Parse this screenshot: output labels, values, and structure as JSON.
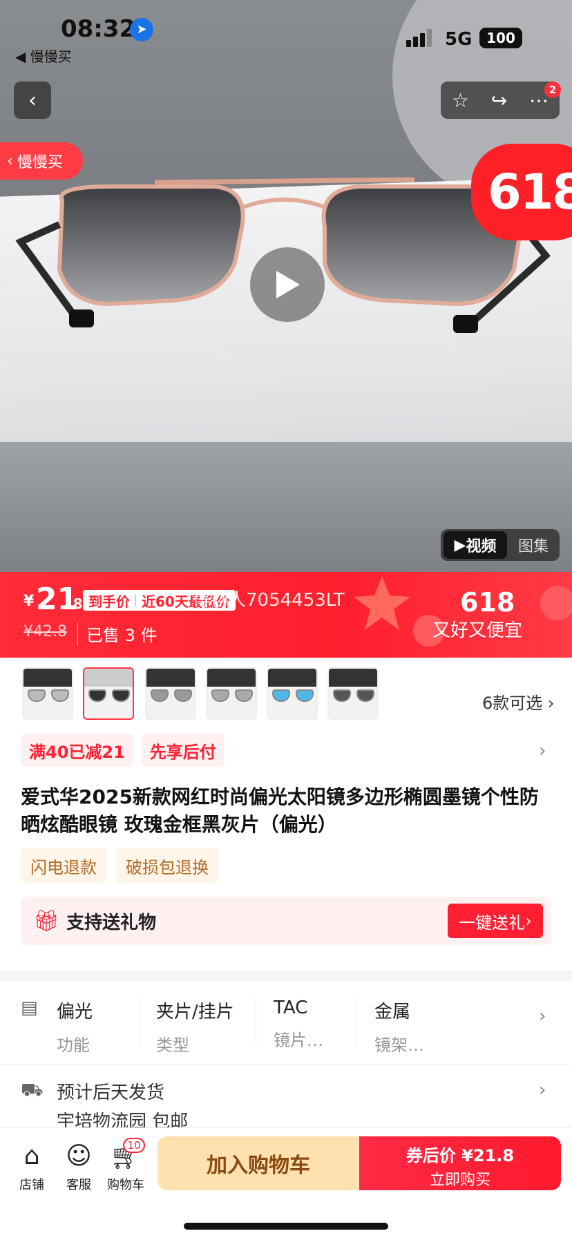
{
  "status_bar": {
    "time": "08:32",
    "back_app": "◀ 慢慢买",
    "network": "5G",
    "battery": "100"
  },
  "hero": {
    "app_pill": "慢慢买",
    "badge_618": "618",
    "media_tabs": [
      "视频",
      "图集"
    ],
    "notification_count": "2"
  },
  "price_bar": {
    "currency": "¥",
    "price_int": "21",
    "price_dec": ".8",
    "tag_1": "到手价",
    "tag_2": "近60天最低价",
    "overlay_text": "得物人7054453LT",
    "old_price": "¥42.8",
    "sold": "已售 3 件",
    "promo_618": "618",
    "promo_text": "又好又便宜"
  },
  "variants": {
    "count_text": "6款可选"
  },
  "promotions": [
    "满40已减21",
    "先享后付"
  ],
  "product_title": "爱式华2025新款网红时尚偏光太阳镜多边形椭圆墨镜个性防晒炫酷眼镜 玫瑰金框黑灰片（偏光）",
  "service_tags": [
    "闪电退款",
    "破损包退换"
  ],
  "gift": {
    "label": "支持送礼物",
    "button": "一键送礼"
  },
  "attributes": [
    {
      "value": "偏光",
      "key": "功能"
    },
    {
      "value": "夹片/挂片",
      "key": "类型"
    },
    {
      "value": "TAC",
      "key": "镜片…"
    },
    {
      "value": "金属",
      "key": "镜架…"
    }
  ],
  "shipping": {
    "line1": "预计后天发货",
    "line2": "宇培物流园  包邮"
  },
  "bottom_bar": {
    "shop": "店铺",
    "service": "客服",
    "cart": "购物车",
    "cart_count": "10",
    "add_to_cart": "加入购物车",
    "buy_line1": "券后价 ¥21.8",
    "buy_line2": "立即购买"
  },
  "colors": {
    "accent_red": "#ff1f2e",
    "tag_bg": "#fff0f1",
    "service_bg": "#fff5e8"
  }
}
